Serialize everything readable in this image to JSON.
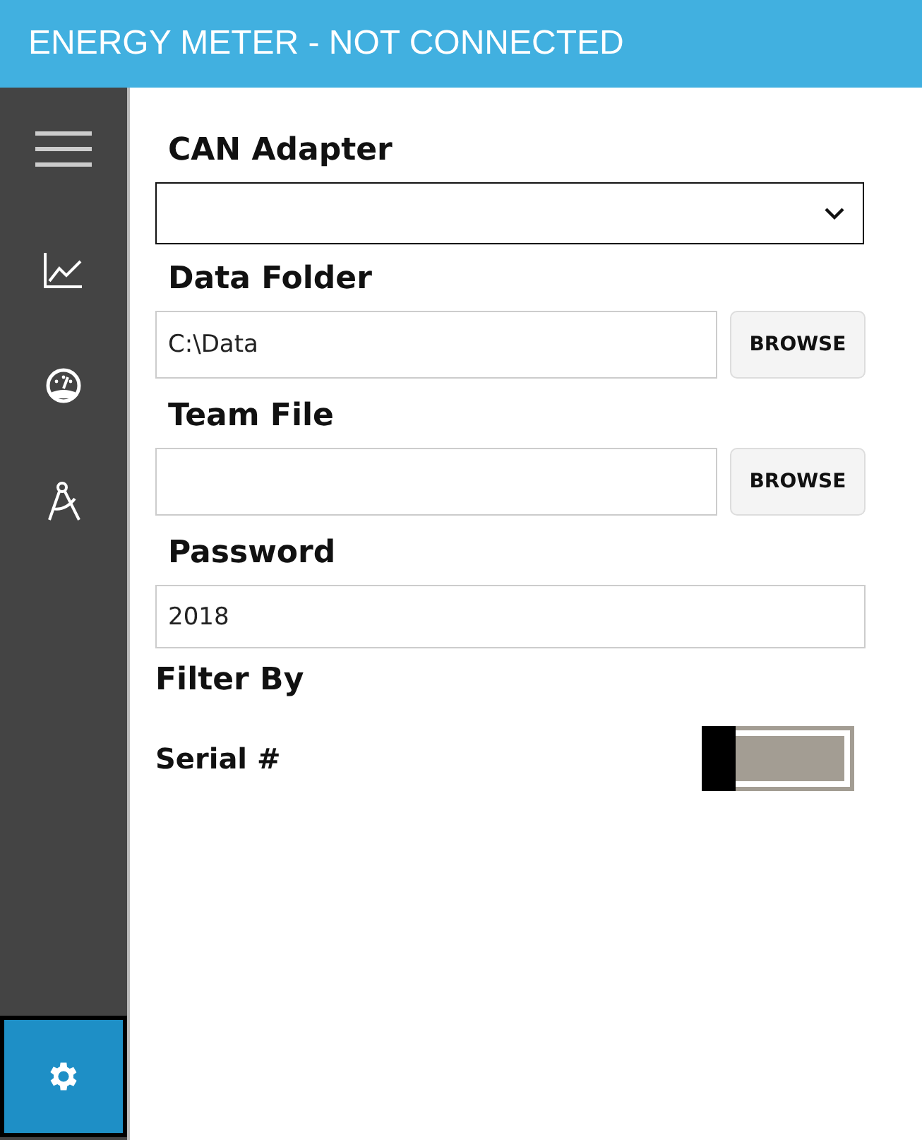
{
  "window": {
    "title": "ENERGY METER - NOT CONNECTED"
  },
  "sidebar": {
    "items": [
      {
        "kind": "chart",
        "selected": false
      },
      {
        "kind": "gauge",
        "selected": false
      },
      {
        "kind": "compass",
        "selected": false
      }
    ],
    "bottom_item": {
      "kind": "settings",
      "selected": true
    }
  },
  "form": {
    "fields": [
      {
        "kind": "dropdown",
        "label": "CAN Adapter"
      },
      {
        "kind": "browse",
        "label": "Data Folder",
        "value": "C:\\Data",
        "button": "BROWSE"
      },
      {
        "kind": "browse",
        "label": "Team File",
        "button": "BROWSE"
      },
      {
        "kind": "text",
        "label": "Password",
        "value": "2018"
      }
    ],
    "filter": {
      "heading": "Filter By",
      "label": "Serial #",
      "on": false
    }
  }
}
